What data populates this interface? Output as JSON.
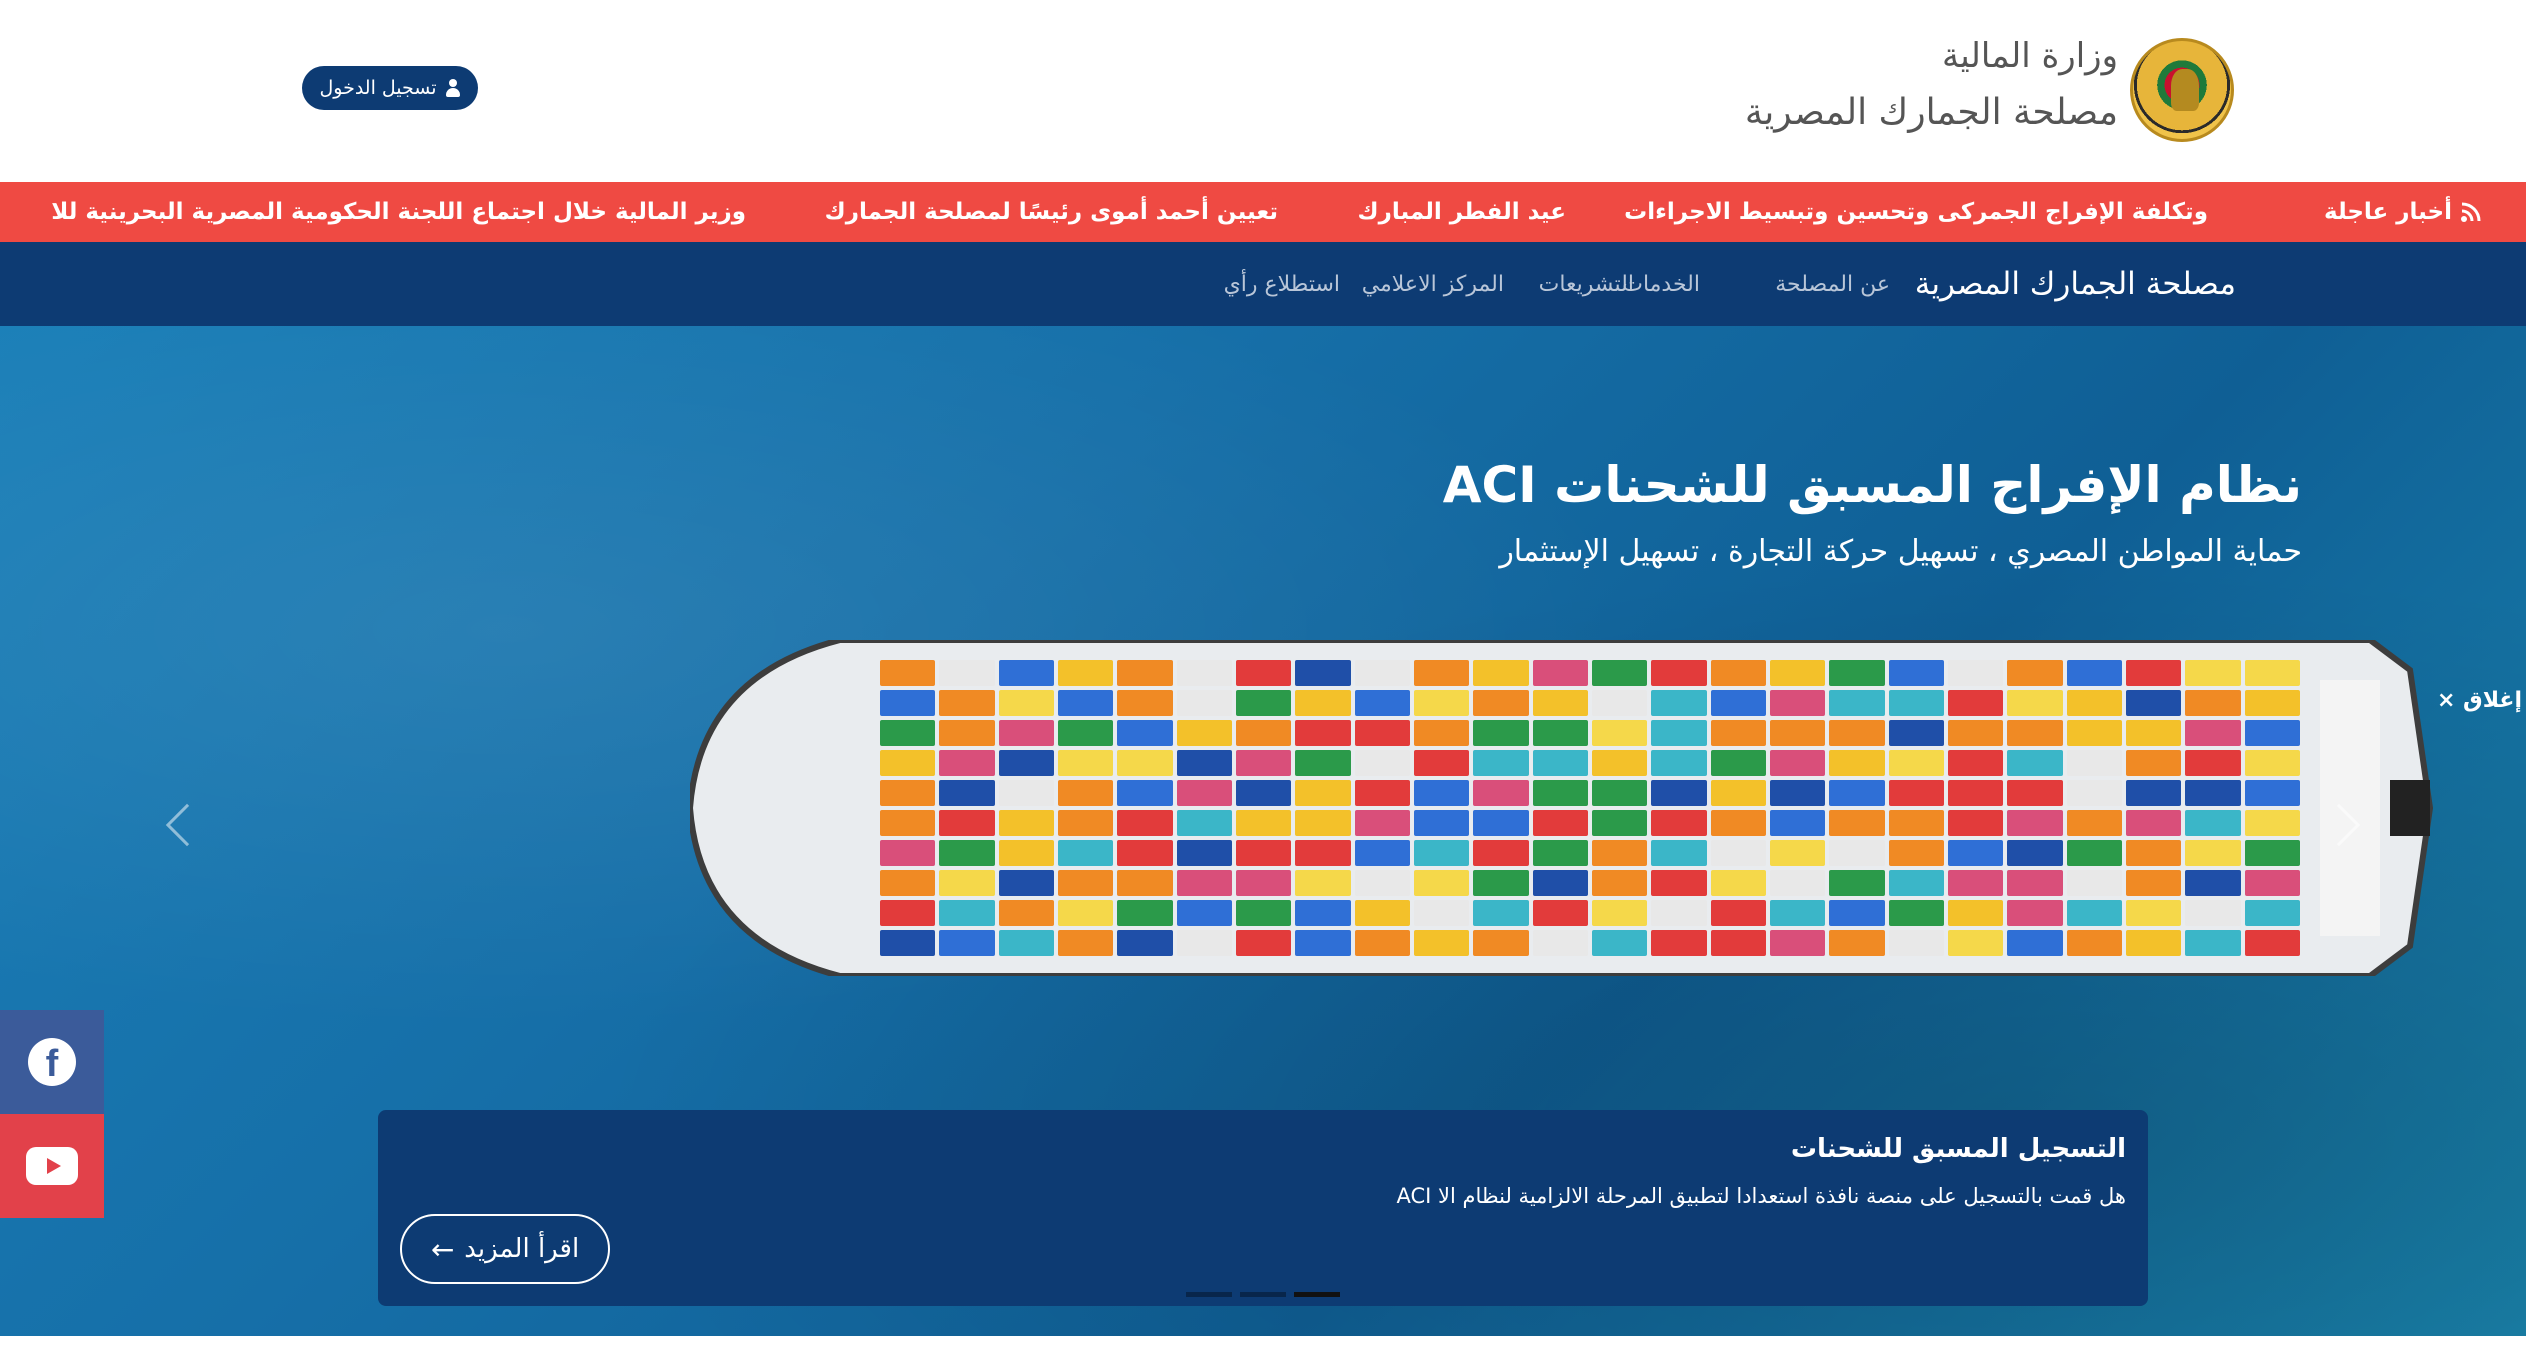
{
  "header": {
    "ministry": "وزارة المالية",
    "authority": "مصلحة الجمارك المصرية",
    "login_label": "تسجيل الدخول"
  },
  "ticker": {
    "label": "أخبار عاجلة",
    "items": [
      "وتكلفة الإفراج الجمركى وتحسين وتبسيط الاجراءات",
      "عيد الفطر المبارك",
      "تعيين أحمد أموى رئيسًا لمصلحة الجمارك",
      "وزير المالية خلال اجتماع اللجنة الحكومية المصرية البحرينية للا"
    ]
  },
  "nav": {
    "brand": "مصلحة الجمارك المصرية",
    "links": [
      "عن المصلحة",
      "الخدمات",
      "التشريعات",
      "المركز الاعلامي",
      "استطلاع رأي"
    ]
  },
  "hero": {
    "title": "نظام الإفراج المسبق للشحنات ACI",
    "subtitle": "حماية المواطن المصري ، تسهيل حركة التجارة ، تسهيل الإستثمار",
    "close_label": "إغلاق ×",
    "card_title": "التسجيل المسبق للشحنات",
    "card_text": "هل قمت بالتسجيل على منصة نافذة استعدادا لتطبيق المرحلة الالزامية لنظام الا ACI",
    "read_more": "اقرأ المزيد",
    "slides": 3,
    "active_slide": 3
  },
  "colors": {
    "navy": "#0d3b73",
    "ticker_red": "#ef4a43",
    "facebook": "#3b5b9a",
    "youtube": "#e2414a"
  },
  "icons": [
    "user-icon",
    "rss-icon",
    "facebook-icon",
    "youtube-icon",
    "arrow-left-icon",
    "chevron-left-icon",
    "chevron-right-icon"
  ]
}
